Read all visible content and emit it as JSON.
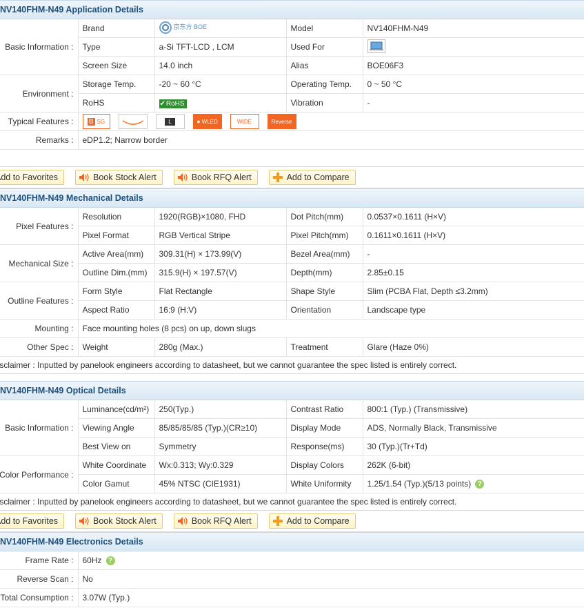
{
  "application": {
    "title": "NV140FHM-N49 Application Details",
    "groups": {
      "basic": "Basic Information :",
      "environment": "Environment :",
      "typical": "Typical Features :",
      "remarks": "Remarks :"
    },
    "rows": {
      "brand": {
        "k1": "Brand",
        "logo_text": "京东方 BOE",
        "k2": "Model",
        "v2": "NV140FHM-N49"
      },
      "type": {
        "k1": "Type",
        "v1": "a-Si TFT-LCD , LCM",
        "k2": "Used For",
        "v2_icon": "laptop-icon"
      },
      "size": {
        "k1": "Screen Size",
        "v1": "14.0 inch",
        "k2": "Alias",
        "v2": "BOE06F3"
      },
      "storage": {
        "k1": "Storage Temp.",
        "v1": "-20 ~ 60 °C",
        "k2": "Operating Temp.",
        "v2": "0 ~ 50 °C"
      },
      "rohs": {
        "k1": "RoHS",
        "badge": "RoHS",
        "k2": "Vibration",
        "v2": "-"
      }
    },
    "features": [
      {
        "icon": "boe-sg-badge",
        "text": "SG"
      },
      {
        "icon": "curved-panel-icon",
        "text": ""
      },
      {
        "icon": "l-letter-icon",
        "text": "L"
      },
      {
        "icon": "wled-badge",
        "text": "WLED"
      },
      {
        "icon": "wide-badge",
        "text": "WIDE"
      },
      {
        "icon": "reverse-badge",
        "text": "Reverse"
      }
    ],
    "remarks_value": "eDP1.2; Narrow border"
  },
  "actions": {
    "favorites": "Add to Favorites",
    "stock": "Book Stock Alert",
    "rfq": "Book RFQ Alert",
    "compare": "Add to Compare"
  },
  "mechanical": {
    "title": "NV140FHM-N49 Mechanical Details",
    "groups": {
      "pixel": "Pixel Features :",
      "mechanical": "Mechanical Size :",
      "outline": "Outline Features :",
      "mounting": "Mounting :",
      "other": "Other Spec :"
    },
    "rows": [
      {
        "k1": "Resolution",
        "v1": "1920(RGB)×1080, FHD",
        "k2": "Dot Pitch(mm)",
        "v2": "0.0537×0.1611 (H×V)"
      },
      {
        "k1": "Pixel Format",
        "v1": "RGB Vertical Stripe",
        "k2": "Pixel Pitch(mm)",
        "v2": "0.1611×0.1611 (H×V)"
      },
      {
        "k1": "Active Area(mm)",
        "v1": "309.31(H) × 173.99(V)",
        "k2": "Bezel Area(mm)",
        "v2": "-"
      },
      {
        "k1": "Outline Dim.(mm)",
        "v1": "315.9(H) × 197.57(V)",
        "k2": "Depth(mm)",
        "v2": "2.85±0.15"
      },
      {
        "k1": "Form Style",
        "v1": "Flat Rectangle",
        "k2": "Shape Style",
        "v2": "Slim (PCBA Flat, Depth ≤3.2mm)"
      },
      {
        "k1": "Aspect Ratio",
        "v1": "16:9 (H:V)",
        "k2": "Orientation",
        "v2": "Landscape type"
      },
      {
        "k1": "Weight",
        "v1": "280g (Max.)",
        "k2": "Treatment",
        "v2": "Glare (Haze 0%)"
      }
    ],
    "mounting_value": "Face mounting holes (8 pcs) on up, down slugs",
    "disclaimer": "Disclaimer : Inputted by panelook engineers according to datasheet, but we cannot guarantee the spec listed is entirely correct."
  },
  "optical": {
    "title": "NV140FHM-N49 Optical Details",
    "groups": {
      "basic": "Basic Information :",
      "color": "Color Performance :"
    },
    "rows": [
      {
        "k1": "Luminance(cd/m²)",
        "v1": "250(Typ.)",
        "k2": "Contrast Ratio",
        "v2": "800:1 (Typ.) (Transmissive)"
      },
      {
        "k1": "Viewing Angle",
        "v1": "85/85/85/85 (Typ.)(CR≥10)",
        "k2": "Display Mode",
        "v2": "ADS, Normally Black, Transmissive"
      },
      {
        "k1": "Best View on",
        "v1": "Symmetry",
        "k2": "Response(ms)",
        "v2": "30 (Typ.)(Tr+Td)"
      },
      {
        "k1": "White Coordinate",
        "v1": "Wx:0.313; Wy:0.329",
        "k2": "Display Colors",
        "v2": "262K (6-bit)"
      },
      {
        "k1": "Color Gamut",
        "v1": "45% NTSC (CIE1931)",
        "k2": "White Uniformity",
        "v2": "1.25/1.54 (Typ.)(5/13 points)"
      }
    ],
    "disclaimer": "Disclaimer : Inputted by panelook engineers according to datasheet, but we cannot guarantee the spec listed is entirely correct."
  },
  "electronics": {
    "title": "NV140FHM-N49 Electronics Details",
    "rows": [
      {
        "label": "Frame Rate :",
        "value": "60Hz"
      },
      {
        "label": "Reverse Scan :",
        "value": "No"
      },
      {
        "label": "Total Consumption :",
        "value": "3.07W (Typ.)"
      }
    ]
  },
  "colors": {
    "header_text": "#1d4f7c",
    "button_border": "#e3c97a",
    "help_green": "#9ccc65",
    "rohs_green": "#2f8f2f",
    "orange": "#f26522"
  }
}
